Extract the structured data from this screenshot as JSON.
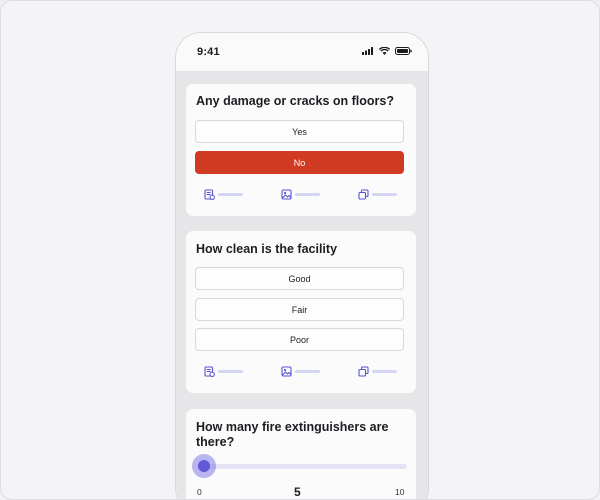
{
  "status_bar": {
    "time": "9:41"
  },
  "questions": [
    {
      "title": "Any damage or cracks on floors?",
      "options": [
        "Yes",
        "No"
      ],
      "selected": "No",
      "actions": [
        "note-icon",
        "image-icon",
        "copy-icon"
      ]
    },
    {
      "title": "How clean is the facility",
      "options": [
        "Good",
        "Fair",
        "Poor"
      ],
      "selected": null,
      "actions": [
        "note-icon",
        "image-icon",
        "copy-icon"
      ]
    },
    {
      "title": "How many fire extinguishers are there?",
      "slider": {
        "min_label": "0",
        "max_label": "10",
        "value_label": "5",
        "position": 0.0
      }
    }
  ],
  "colors": {
    "selected_option": "#d13a22",
    "accent": "#6257d9",
    "action_bar": "#d4d4f3"
  }
}
